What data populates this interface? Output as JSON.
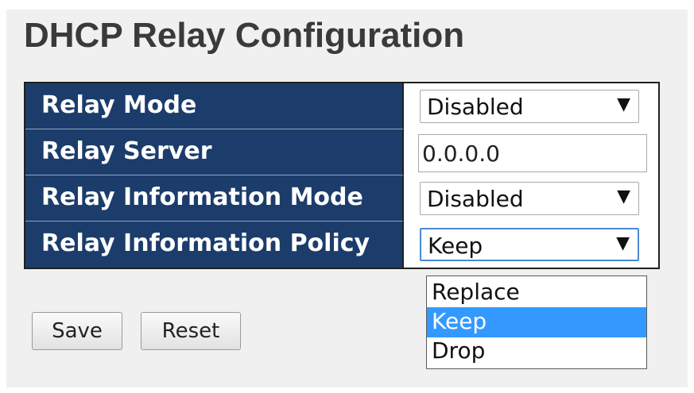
{
  "page": {
    "title": "DHCP Relay Configuration"
  },
  "config": {
    "rows": [
      {
        "label": "Relay Mode",
        "type": "select",
        "value": "Disabled"
      },
      {
        "label": "Relay Server",
        "type": "text",
        "value": "0.0.0.0"
      },
      {
        "label": "Relay Information Mode",
        "type": "select",
        "value": "Disabled"
      },
      {
        "label": "Relay Information Policy",
        "type": "select",
        "value": "Keep"
      }
    ]
  },
  "policy_dropdown": {
    "options": [
      "Replace",
      "Keep",
      "Drop"
    ],
    "highlighted": "Keep"
  },
  "buttons": {
    "save_label": "Save",
    "reset_label": "Reset"
  },
  "icons": {
    "dropdown_arrow": "chevron-down-icon",
    "arrow_glyph": "▼"
  },
  "colors": {
    "label_background": "#1c3d6b",
    "label_text": "#ffffff",
    "highlight": "#3399ff",
    "panel_background": "#f0f0f0"
  }
}
